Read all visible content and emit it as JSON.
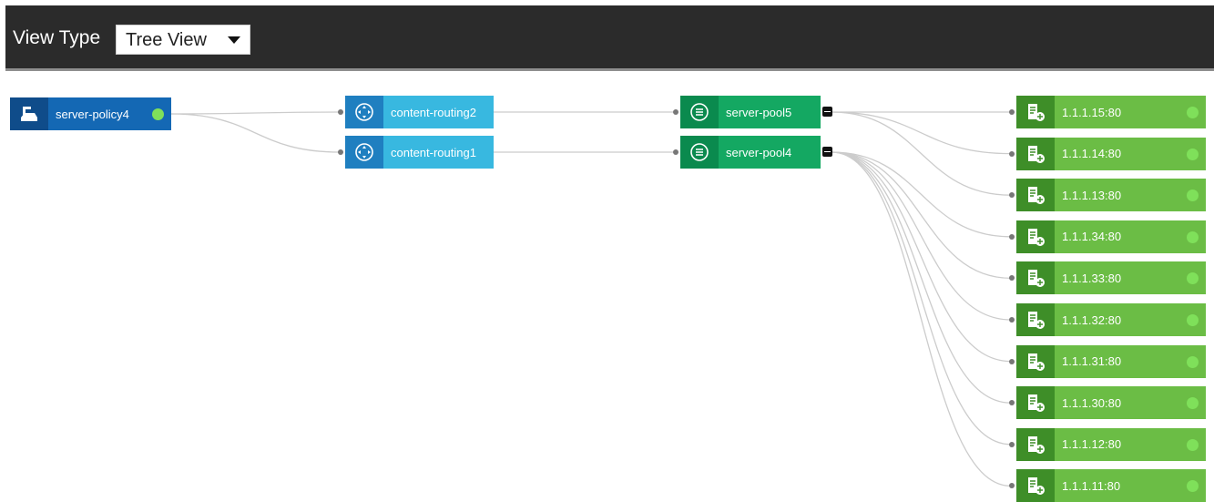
{
  "toolbar": {
    "view_type_label": "View Type",
    "view_type_value": "Tree View",
    "background": "#2b2b2b"
  },
  "colors": {
    "policy_icon_bg": "#0f4c8a",
    "policy_body": "#1468b4",
    "routing_icon_bg": "#1f7fc0",
    "routing_body": "#38b8e0",
    "pool_icon_bg": "#0a8a4e",
    "pool_body": "#14a862",
    "server_icon_bg": "#3e8e28",
    "server_body": "#6bbd45",
    "status_up": "#7fe05a",
    "link": "#cccccc"
  },
  "nodes": [
    {
      "id": "policy",
      "type": "policy",
      "label": "server-policy4",
      "icon": "policy-icon",
      "status": "up"
    },
    {
      "id": "cr2",
      "type": "routing",
      "label": "content-routing2",
      "icon": "routing-icon"
    },
    {
      "id": "cr1",
      "type": "routing",
      "label": "content-routing1",
      "icon": "routing-icon"
    },
    {
      "id": "pool5",
      "type": "pool",
      "label": "server-pool5",
      "icon": "list-icon",
      "collapsible": true
    },
    {
      "id": "pool4",
      "type": "pool",
      "label": "server-pool4",
      "icon": "list-icon",
      "collapsible": true
    },
    {
      "id": "s1",
      "type": "server",
      "label": "1.1.1.15:80",
      "icon": "server-icon",
      "status": "up"
    },
    {
      "id": "s2",
      "type": "server",
      "label": "1.1.1.14:80",
      "icon": "server-icon",
      "status": "up"
    },
    {
      "id": "s3",
      "type": "server",
      "label": "1.1.1.13:80",
      "icon": "server-icon",
      "status": "up"
    },
    {
      "id": "s4",
      "type": "server",
      "label": "1.1.1.34:80",
      "icon": "server-icon",
      "status": "up"
    },
    {
      "id": "s5",
      "type": "server",
      "label": "1.1.1.33:80",
      "icon": "server-icon",
      "status": "up"
    },
    {
      "id": "s6",
      "type": "server",
      "label": "1.1.1.32:80",
      "icon": "server-icon",
      "status": "up"
    },
    {
      "id": "s7",
      "type": "server",
      "label": "1.1.1.31:80",
      "icon": "server-icon",
      "status": "up"
    },
    {
      "id": "s8",
      "type": "server",
      "label": "1.1.1.30:80",
      "icon": "server-icon",
      "status": "up"
    },
    {
      "id": "s9",
      "type": "server",
      "label": "1.1.1.12:80",
      "icon": "server-icon",
      "status": "up"
    },
    {
      "id": "s10",
      "type": "server",
      "label": "1.1.1.11:80",
      "icon": "server-icon",
      "status": "up"
    }
  ],
  "edges": [
    [
      "policy",
      "cr2"
    ],
    [
      "policy",
      "cr1"
    ],
    [
      "cr2",
      "pool5"
    ],
    [
      "cr1",
      "pool4"
    ],
    [
      "pool5",
      "s1"
    ],
    [
      "pool5",
      "s2"
    ],
    [
      "pool5",
      "s3"
    ],
    [
      "pool4",
      "s4"
    ],
    [
      "pool4",
      "s5"
    ],
    [
      "pool4",
      "s6"
    ],
    [
      "pool4",
      "s7"
    ],
    [
      "pool4",
      "s8"
    ],
    [
      "pool4",
      "s9"
    ],
    [
      "pool4",
      "s10"
    ]
  ]
}
